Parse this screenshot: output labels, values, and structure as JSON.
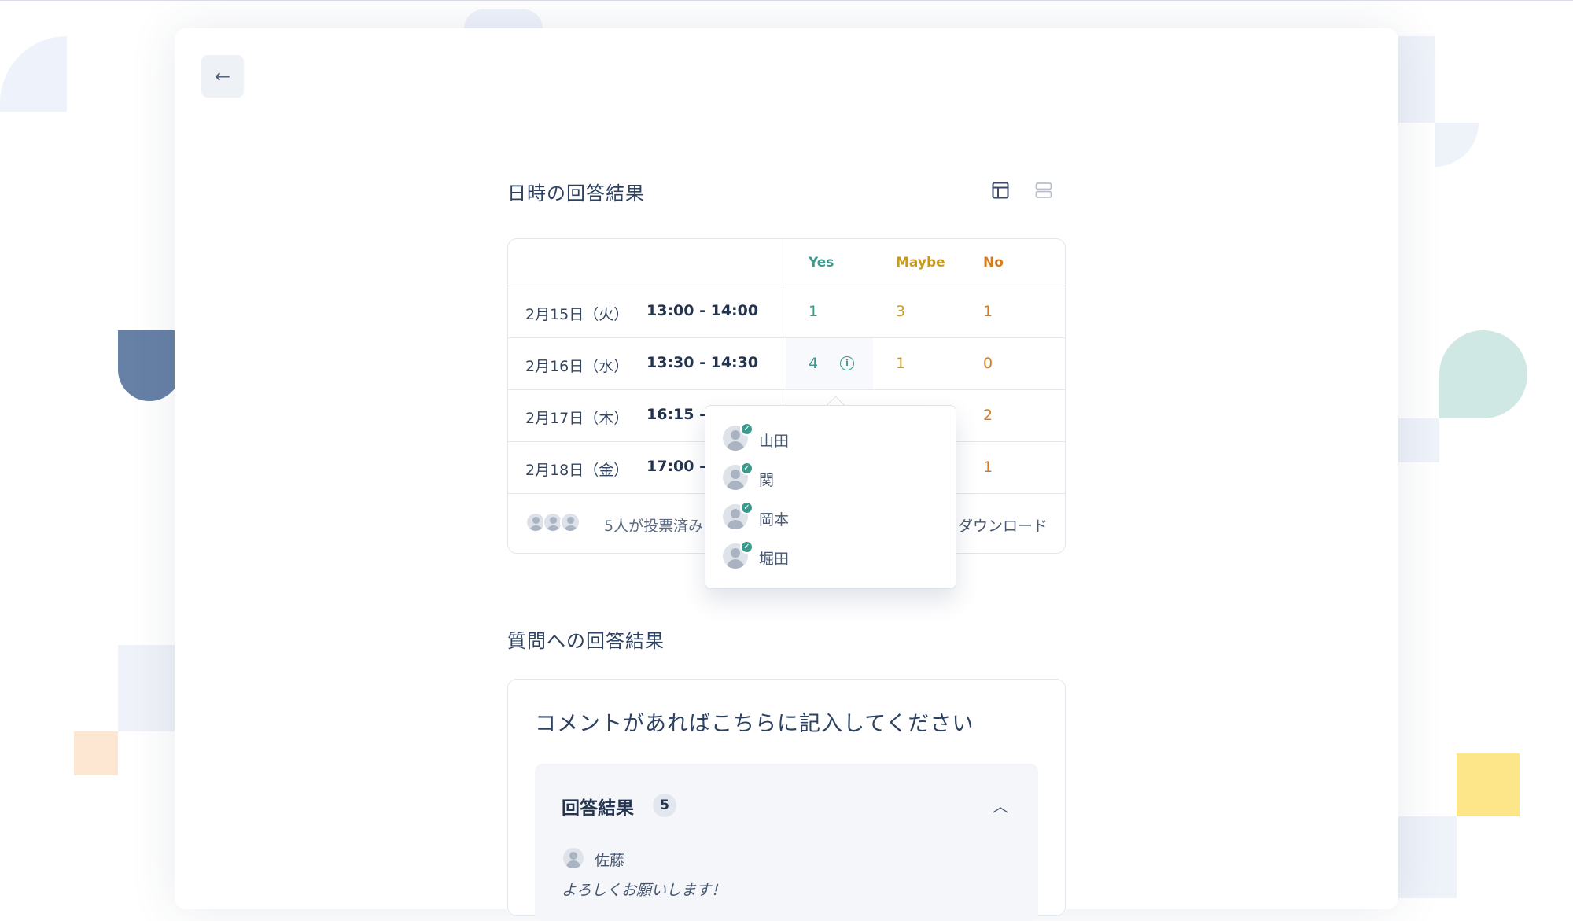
{
  "navigation": {
    "back_icon": "arrow-left-icon"
  },
  "datetime_results": {
    "title": "日時の回答結果",
    "view_icons": [
      "table-view-icon",
      "list-view-icon"
    ],
    "headers": {
      "yes": "Yes",
      "maybe": "Maybe",
      "no": "No"
    },
    "rows": [
      {
        "date": "2月15日（火）",
        "time": "13:00 - 14:00",
        "yes": "1",
        "maybe": "3",
        "no": "1"
      },
      {
        "date": "2月16日（水）",
        "time": "13:30 - 14:30",
        "yes": "4",
        "maybe": "1",
        "no": "0"
      },
      {
        "date": "2月17日（木）",
        "time": "16:15 - 1",
        "yes": "",
        "maybe": "",
        "no": "2"
      },
      {
        "date": "2月18日（金）",
        "time": "17:00 -",
        "yes": "",
        "maybe": "",
        "no": "1"
      }
    ],
    "voted_text": "5人が投票済み",
    "download_text": "ダウンロード"
  },
  "yes_popover": {
    "voters": [
      "山田",
      "関",
      "岡本",
      "堀田"
    ]
  },
  "question_results": {
    "title": "質問への回答結果",
    "question": "コメントがあればこちらに記入してください",
    "results_label": "回答結果",
    "results_count": "5",
    "responses": [
      {
        "name": "佐藤",
        "comment": "よろしくお願いします！"
      }
    ]
  },
  "colors": {
    "yes": "#3b9a8c",
    "maybe": "#c99a18",
    "no": "#d97a1c"
  }
}
